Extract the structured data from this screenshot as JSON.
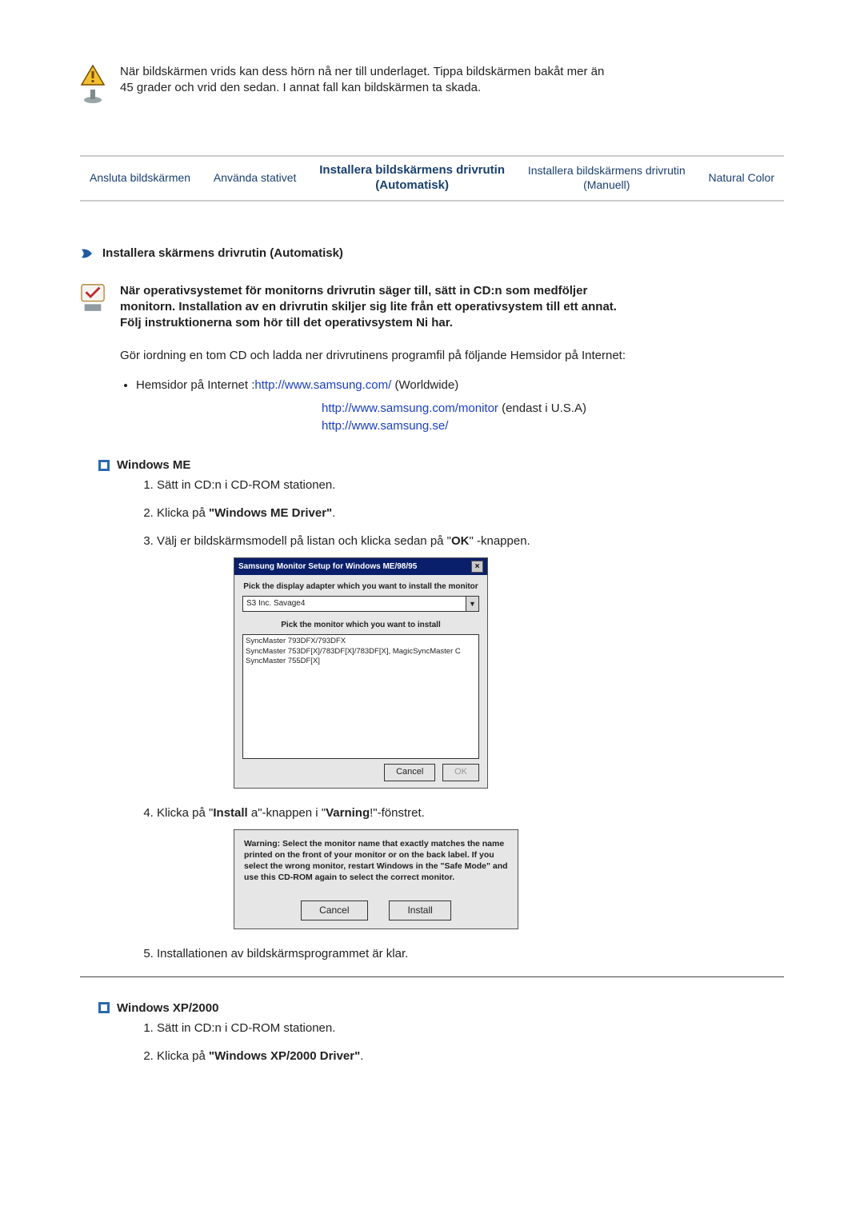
{
  "warning": {
    "line1": "När bildskärmen vrids kan dess hörn nå ner till underlaget. Tippa bildskärmen bakåt mer än",
    "line2": "45 grader och vrid den sedan. I annat fall kan bildskärmen ta skada."
  },
  "nav": {
    "item1": "Ansluta bildskärmen",
    "item2": "Använda stativet",
    "item3_line1": "Installera bildskärmens drivrutin",
    "item3_line2": "(Automatisk)",
    "item4_line1": "Installera bildskärmens drivrutin",
    "item4_line2": "(Manuell)",
    "item5": "Natural Color"
  },
  "section_heading": "Installera skärmens drivrutin (Automatisk)",
  "intro": {
    "l1": "När operativsystemet för monitorns drivrutin säger till, sätt in CD:n som medföljer",
    "l2": "monitorn. Installation av en drivrutin skiljer sig lite från ett operativsystem till ett annat.",
    "l3": "Följ instruktionerna som hör till det operativsystem Ni har."
  },
  "prep_text": "Gör iordning en tom CD och ladda ner drivrutinens programfil på följande Hemsidor på Internet:",
  "links": {
    "bullet_label": "Hemsidor på Internet :",
    "l1_url": "http://www.samsung.com/",
    "l1_suffix": " (Worldwide)",
    "l2_url": "http://www.samsung.com/monitor",
    "l2_suffix": " (endast i U.S.A)",
    "l3_url": "http://www.samsung.se/"
  },
  "me_heading": "Windows ME",
  "me_steps": {
    "s1": "Sätt in CD:n i CD-ROM stationen.",
    "s2_pre": "Klicka på ",
    "s2_bold": "\"Windows ME Driver\"",
    "s2_post": ".",
    "s3_pre": "Välj er bildskärmsmodell på listan och klicka sedan på \"",
    "s3_bold": "OK",
    "s3_post": "\" -knappen.",
    "s4_pre": "Klicka på \"",
    "s4_b1": "Install",
    "s4_mid": " a\"-knappen i \"",
    "s4_b2": "Varning",
    "s4_post": "!\"-fönstret.",
    "s5": "Installationen av bildskärmsprogrammet är klar."
  },
  "dlg1": {
    "title": "Samsung Monitor Setup for Windows ME/98/95",
    "lbl1": "Pick the display adapter which you want to install the monitor",
    "combo": "S3 Inc. Savage4",
    "lbl2": "Pick the monitor which you want to install",
    "row1": "SyncMaster 793DFX/793DFX",
    "row2": "SyncMaster 753DF[X]/783DF[X]/783DF[X], MagicSyncMaster C",
    "row3": "SyncMaster 755DF[X]",
    "cancel": "Cancel",
    "ok": "OK"
  },
  "dlg2": {
    "text": "Warning: Select the monitor name that exactly matches the name printed on the front of your monitor or on the back label. If you select the wrong monitor, restart Windows in the \"Safe Mode\" and use this CD-ROM again to select the correct monitor.",
    "cancel": "Cancel",
    "install": "Install"
  },
  "xp_heading": "Windows XP/2000",
  "xp_steps": {
    "s1": "Sätt in CD:n i CD-ROM stationen.",
    "s2_pre": "Klicka på ",
    "s2_bold": "\"Windows XP/2000 Driver\"",
    "s2_post": "."
  }
}
